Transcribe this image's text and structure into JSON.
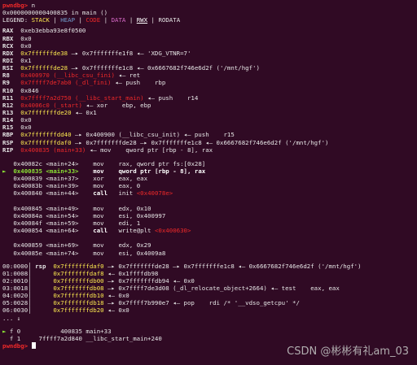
{
  "prompt": "pwndbg>",
  "command": "n",
  "location": "0x0000000000400835 in main ()",
  "legend": {
    "label": "LEGEND:",
    "items": [
      "STACK",
      "HEAP",
      "CODE",
      "DATA",
      "RWX",
      "RODATA"
    ],
    "sep": " | ",
    "colors": {
      "STACK": "#fce94f",
      "HEAP": "#729fcf",
      "CODE": "#ef2929",
      "DATA": "#d669c6",
      "RWX": "#ffffff",
      "RODATA": "#e6e6e6"
    }
  },
  "registers": [
    {
      "name": "RAX",
      "value": "0xeb3ebba93e8f0500"
    },
    {
      "name": "RBX",
      "value": "0x0"
    },
    {
      "name": "RCX",
      "value": "0x0"
    },
    {
      "name": "RDX",
      "value": "0x7ffffffde38",
      "chain": "—▸ 0x7fffffffe1f8 ◂— 'XDG_VTNR=7'"
    },
    {
      "name": "RDI",
      "value": "0x1"
    },
    {
      "name": "RSI",
      "value": "0x7ffffffde28",
      "chain": "—▸ 0x7fffffffe1c8 ◂— 0x6667682f746e6d2f ('/mnt/hgf')"
    },
    {
      "name": "R8",
      "value": "0x400970 (__libc_csu_fini)",
      "chain": "◂— ret"
    },
    {
      "name": "R9",
      "value": "0x7ffff7de7ab0 (_dl_fini)",
      "chain": "◂— push    rbp"
    },
    {
      "name": "R10",
      "value": "0x846"
    },
    {
      "name": "R11",
      "value": "0x7ffff7a2d750 (__libc_start_main)",
      "chain": "◂— push    r14"
    },
    {
      "name": "R12",
      "value": "0x4006c0 (_start)",
      "chain": "◂— xor    ebp, ebp"
    },
    {
      "name": "R13",
      "value": "0x7fffffffde20",
      "chain": "◂— 0x1"
    },
    {
      "name": "R14",
      "value": "0x0"
    },
    {
      "name": "R15",
      "value": "0x0"
    },
    {
      "name": "RBP",
      "value": "0x7fffffffdd40",
      "chain": "—▸ 0x400900 (__libc_csu_init) ◂— push    r15"
    },
    {
      "name": "RSP",
      "value": "0x7fffffffdaf0",
      "chain": "—▸ 0x7fffffffde28 —▸ 0x7fffffffe1c8 ◂— 0x6667682f746e6d2f ('/mnt/hgf')"
    },
    {
      "name": "RIP",
      "value": "0x400835 (main+33)",
      "chain": "◂— mov    qword ptr [rbp - 8], rax"
    }
  ],
  "disasm": [
    {
      "addr": "0x40082c",
      "sym": "<main+24>",
      "mnem": "mov",
      "ops": "rax, qword ptr fs:[0x28]"
    },
    {
      "current": true,
      "marker": "►",
      "addr": "0x400835",
      "sym": "<main+33>",
      "mnem": "mov",
      "ops": "qword ptr [rbp - 8], rax"
    },
    {
      "addr": "0x400839",
      "sym": "<main+37>",
      "mnem": "xor",
      "ops": "eax, eax"
    },
    {
      "addr": "0x40083b",
      "sym": "<main+39>",
      "mnem": "mov",
      "ops": "eax, 0"
    },
    {
      "addr": "0x400840",
      "sym": "<main+44>",
      "mnem": "call",
      "ops": "init",
      "target": "<0x40078e>"
    },
    {
      "gap": true
    },
    {
      "addr": "0x400845",
      "sym": "<main+49>",
      "mnem": "mov",
      "ops": "edx, 0x10"
    },
    {
      "addr": "0x40084a",
      "sym": "<main+54>",
      "mnem": "mov",
      "ops": "esi, 0x400997"
    },
    {
      "addr": "0x40084f",
      "sym": "<main+59>",
      "mnem": "mov",
      "ops": "edi, 1"
    },
    {
      "addr": "0x400854",
      "sym": "<main+64>",
      "mnem": "call",
      "ops": "write@plt",
      "target": "<0x400630>"
    },
    {
      "gap": true
    },
    {
      "addr": "0x400859",
      "sym": "<main+69>",
      "mnem": "mov",
      "ops": "edx, 0x29"
    },
    {
      "addr": "0x40085e",
      "sym": "<main+74>",
      "mnem": "mov",
      "ops": "esi, 0x4009a8"
    }
  ],
  "stack": [
    {
      "idx": "00:0000",
      "reg": "rsp",
      "addr": "0x7fffffffdaf0",
      "chain": "—▸ 0x7fffffffde28 —▸ 0x7fffffffe1c8 ◂— 0x6667682f746e6d2f ('/mnt/hgf')"
    },
    {
      "idx": "01:0008",
      "reg": "",
      "addr": "0x7fffffffdaf8",
      "chain": "◂— 0x1ffffdb98"
    },
    {
      "idx": "02:0010",
      "reg": "",
      "addr": "0x7fffffffdb00",
      "chain": "—▸ 0x7fffffffdb94 ◂— 0x0"
    },
    {
      "idx": "03:0018",
      "reg": "",
      "addr": "0x7fffffffdb08",
      "chain": "—▸ 0x7ffff7de3d08 (_dl_relocate_object+2664) ◂— test    eax, eax"
    },
    {
      "idx": "04:0020",
      "reg": "",
      "addr": "0x7fffffffdb10",
      "chain": "◂— 0x0"
    },
    {
      "idx": "05:0028",
      "reg": "",
      "addr": "0x7fffffffdb18",
      "chain": "—▸ 0x7ffff7b990e7 ◂— pop    rdi /* '__vdso_getcpu' */"
    },
    {
      "idx": "06:0030",
      "reg": "",
      "addr": "0x7fffffffdb20",
      "chain": "◂— 0x0"
    },
    {
      "idx": "... ↓",
      "reg": "",
      "addr": "",
      "chain": ""
    }
  ],
  "backtrace": [
    {
      "marker": "►",
      "frame": "f 0",
      "addr": "400835",
      "sym": "main+33"
    },
    {
      "marker": "",
      "frame": "f 1",
      "addr": "7ffff7a2d840",
      "sym": "__libc_start_main+240"
    }
  ],
  "watermark": "CSDN @彬彬有礼am_03"
}
